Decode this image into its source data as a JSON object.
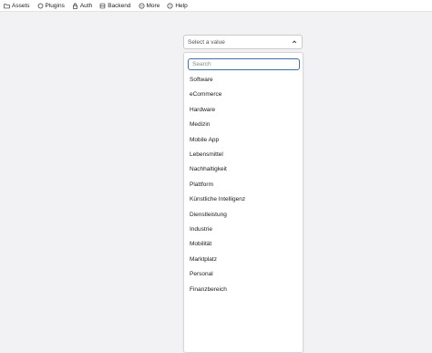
{
  "nav": [
    {
      "label": "Assets",
      "icon": "folder-icon"
    },
    {
      "label": "Plugins",
      "icon": "plugin-icon"
    },
    {
      "label": "Auth",
      "icon": "lock-icon"
    },
    {
      "label": "Backend",
      "icon": "database-icon"
    },
    {
      "label": "More",
      "icon": "more-icon"
    },
    {
      "label": "Help",
      "icon": "help-icon"
    }
  ],
  "select": {
    "placeholder": "Select a value",
    "icon": "chevron-up-icon"
  },
  "search": {
    "placeholder": "Search",
    "value": ""
  },
  "options": [
    "Software",
    "eCommerce",
    "Hardware",
    "Medizin",
    "Mobile App",
    "Lebensmittel",
    "Nachhaltigkeit",
    "Plattform",
    "Künstliche Intelligenz",
    "Dienstleistung",
    "Industrie",
    "Mobilität",
    "Marktplatz",
    "Personal",
    "Finanzbereich"
  ],
  "colors": {
    "focus_border": "#3f6fa8",
    "background": "#f2f2f5"
  }
}
